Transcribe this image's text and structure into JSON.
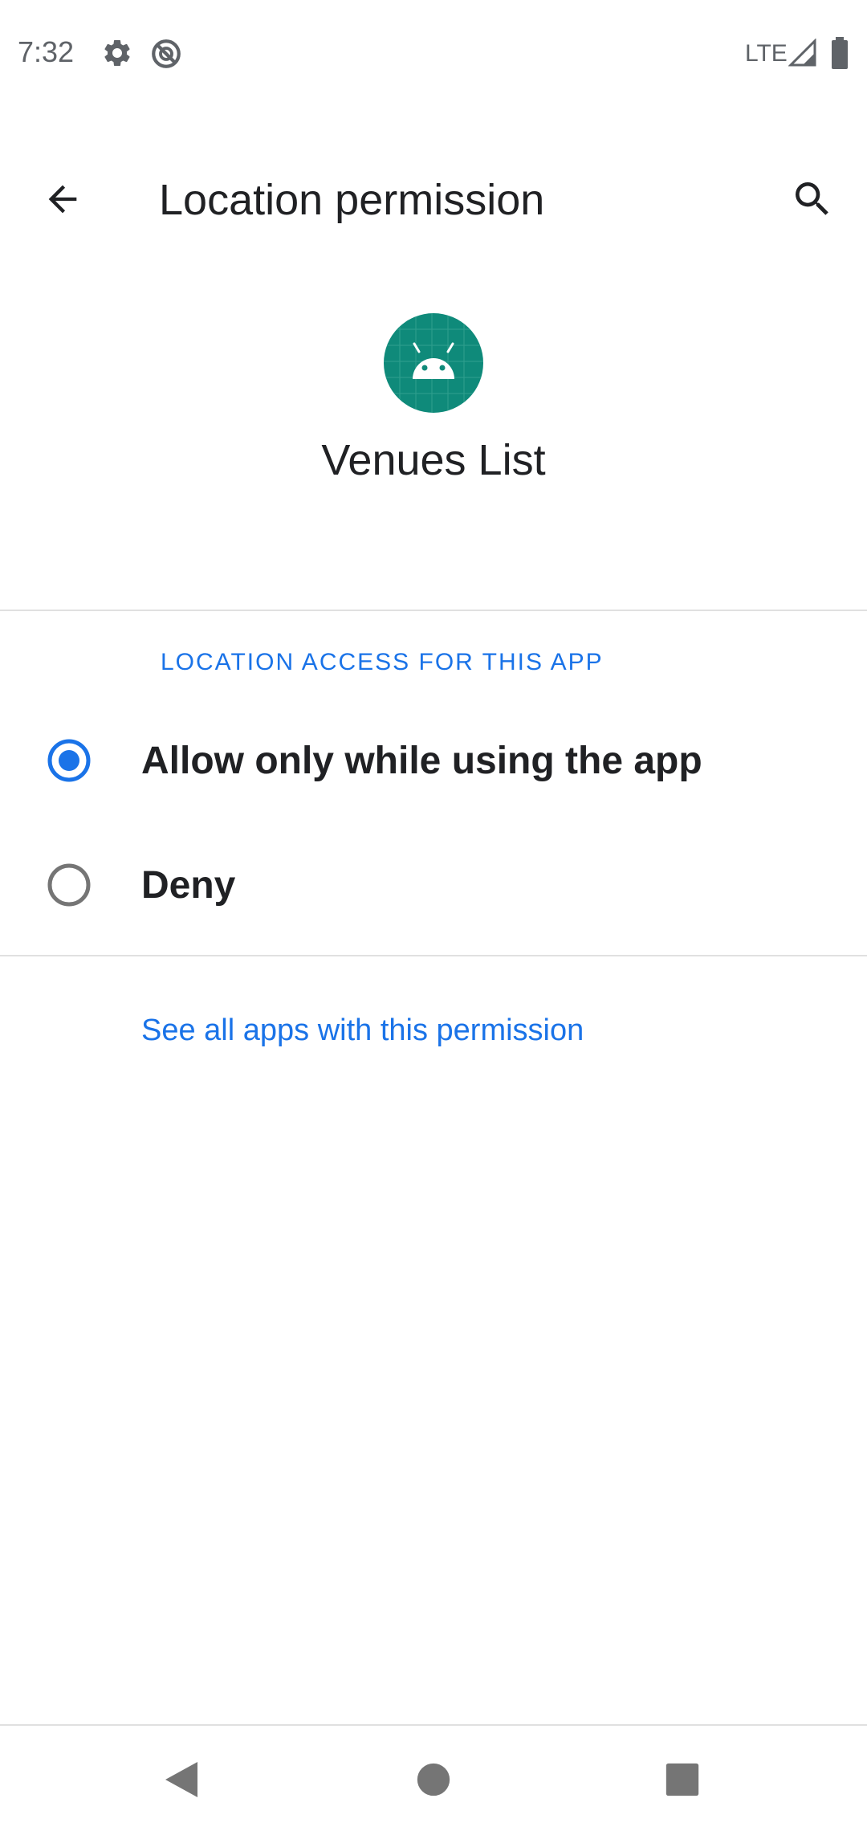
{
  "status_bar": {
    "time": "7:32",
    "icons": [
      "gear-icon",
      "do-not-disturb-icon",
      "signal-icon",
      "battery-icon"
    ],
    "network": "LTE"
  },
  "app_bar": {
    "title": "Location permission",
    "back_icon": "arrow-back-icon",
    "search_icon": "search-icon"
  },
  "app": {
    "name": "Venues List",
    "icon": "android-icon",
    "icon_color": "#0f8a7a"
  },
  "permissions": {
    "section_label": "LOCATION ACCESS FOR THIS APP",
    "options": [
      {
        "label": "Allow only while using the app",
        "selected": true
      },
      {
        "label": "Deny",
        "selected": false
      }
    ],
    "see_all_link": "See all apps with this permission"
  },
  "nav": {
    "back_icon": "nav-back-icon",
    "home_icon": "nav-home-icon",
    "recents_icon": "nav-recents-icon"
  },
  "colors": {
    "accent": "#1a73e8",
    "text": "#202124",
    "divider": "#e0e0e0"
  }
}
